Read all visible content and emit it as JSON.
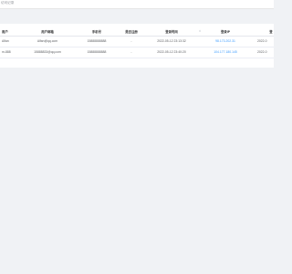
{
  "page": {
    "title": "访问记录"
  },
  "table": {
    "columns": {
      "user": "用户",
      "email": "用户邮箱",
      "phone": "手机号",
      "register": "是否注册",
      "time": "登录时间",
      "ip": "登录IP",
      "extra": "登"
    },
    "rows": [
      {
        "user": "Alfan",
        "email": "Alfan@qq.com",
        "phone": "15888888888",
        "register": "-",
        "time": "2022-05-12 23:13:32",
        "ip": "98.173.202.31",
        "extra": "2022-0"
      },
      {
        "user": "m-888",
        "email": "15888833@qq.com",
        "phone": "15888888888",
        "register": "-",
        "time": "2022-05-12 23:40:20",
        "ip": "104.177.180.145",
        "extra": "2022-0"
      }
    ]
  },
  "colors": {
    "link": "#409eff",
    "background": "#f0f2f5"
  }
}
